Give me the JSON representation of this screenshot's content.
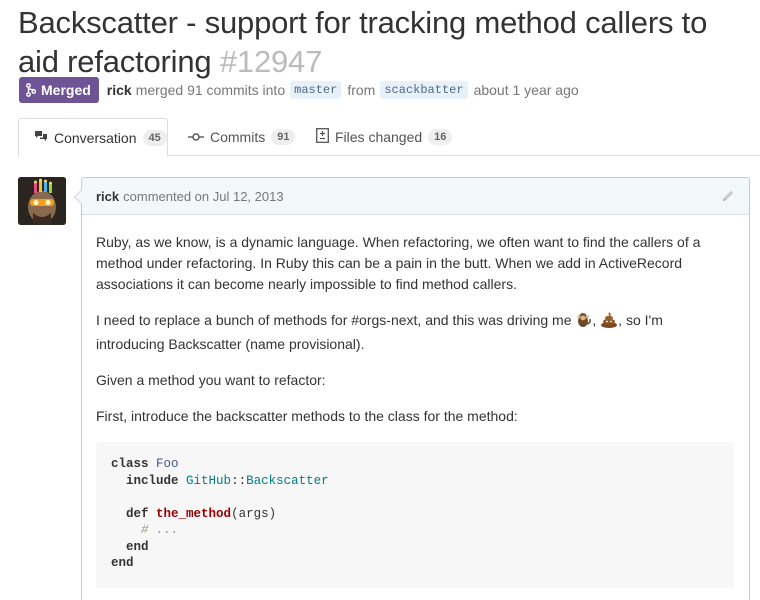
{
  "pr": {
    "title": "Backscatter - support for tracking method callers to aid refactoring",
    "number": "#12947",
    "state": "Merged",
    "author": "rick",
    "merged_text": "merged 91 commits into",
    "base_branch": "master",
    "from_text": "from",
    "head_branch": "scackbatter",
    "time_text": "about 1 year ago"
  },
  "tabs": [
    {
      "label": "Conversation",
      "count": "45",
      "icon": "comment-discussion-icon"
    },
    {
      "label": "Commits",
      "count": "91",
      "icon": "git-commit-icon"
    },
    {
      "label": "Files changed",
      "count": "16",
      "icon": "diff-icon"
    }
  ],
  "comment": {
    "author": "rick",
    "action": "commented on Jul 12, 2013",
    "paragraphs": {
      "p1": "Ruby, as we know, is a dynamic language. When refactoring, we often want to find the callers of a method under refactoring. In Ruby this can be a pain in the butt. When we add in ActiveRecord associations it can become nearly impossible to find method callers.",
      "p2_before": "I need to replace a bunch of methods for #orgs-next, and this was driving me",
      "p2_after": ", so I'm introducing Backscatter (name provisional).",
      "p3": "Given a method you want to refactor:",
      "p4": "First, introduce the backscatter methods to the class for the method:"
    },
    "code": {
      "l1_kw": "class",
      "l1_name": "Foo",
      "l2_kw": "include",
      "l2_mod": "GitHub",
      "l2_sep": "::",
      "l2_cls": "Backscatter",
      "l3_kw": "def",
      "l3_fn": "the_method",
      "l3_args": "(args)",
      "l4_cmt": "# ...",
      "l5_kw": "end",
      "l6_kw": "end"
    }
  },
  "colors": {
    "merged": "#6e5494",
    "header_bg": "#f2f8fa",
    "code_bg": "#f7f7f7"
  }
}
